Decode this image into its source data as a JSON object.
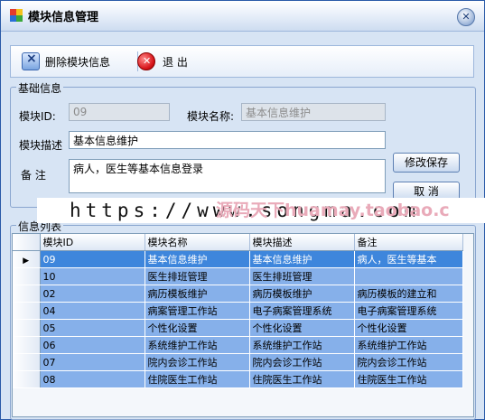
{
  "window": {
    "title": "模块信息管理",
    "close_glyph": "✕"
  },
  "toolbar": {
    "delete_label": "删除模块信息",
    "exit_label": "退 出"
  },
  "basic": {
    "legend": "基础信息",
    "module_id_label": "模块ID:",
    "module_id_value": "09",
    "module_name_label": "模块名称:",
    "module_name_value": "基本信息维护",
    "module_desc_label": "模块描述",
    "module_desc_value": "基本信息维护",
    "remark_label": "备 注",
    "remark_value": "病人，医生等基本信息登录",
    "save_label": "修改保存",
    "cancel_label": "取 消"
  },
  "watermark": {
    "url_text": "https://www.songma.com",
    "shop_text": "源码天下huamay.taobao.c"
  },
  "list": {
    "legend": "信息列表",
    "columns": [
      "模块ID",
      "模块名称",
      "模块描述",
      "备注"
    ],
    "rows": [
      [
        "09",
        "基本信息维护",
        "基本信息维护",
        "病人，医生等基本"
      ],
      [
        "10",
        "医生排班管理",
        "医生排班管理",
        ""
      ],
      [
        "02",
        "病历模板维护",
        "病历模板维护",
        "病历模板的建立和"
      ],
      [
        "04",
        "病案管理工作站",
        "电子病案管理系统",
        "电子病案管理系统"
      ],
      [
        "05",
        "个性化设置",
        "个性化设置",
        "个性化设置"
      ],
      [
        "06",
        "系统维护工作站",
        "系统维护工作站",
        "系统维护工作站"
      ],
      [
        "07",
        "院内会诊工作站",
        "院内会诊工作站",
        "院内会诊工作站"
      ],
      [
        "08",
        "住院医生工作站",
        "住院医生工作站",
        "住院医生工作站"
      ]
    ],
    "selected_row": 0,
    "pointer_glyph": "▶"
  },
  "colors": {
    "selected_row": "#3e86dc",
    "row": "#86b0ea",
    "window_bg": "#d7e4f4"
  }
}
